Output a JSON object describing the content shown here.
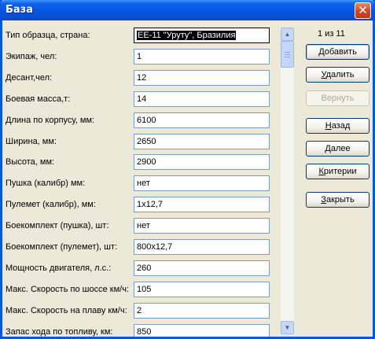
{
  "window": {
    "title": "База",
    "close_glyph": "✕"
  },
  "form": {
    "fields": [
      {
        "label": "Тип образца, страна:",
        "value": "EE-11 \"Уруту\", Бразилия",
        "selected": true
      },
      {
        "label": "Экипаж, чел:",
        "value": "1"
      },
      {
        "label": "Десант,чел:",
        "value": "12"
      },
      {
        "label": "Боевая масса,т:",
        "value": "14"
      },
      {
        "label": "Длина по корпусу, мм:",
        "value": "6100"
      },
      {
        "label": "Ширина, мм:",
        "value": "2650"
      },
      {
        "label": "Высота, мм:",
        "value": "2900"
      },
      {
        "label": "Пушка (калибр) мм:",
        "value": "нет"
      },
      {
        "label": "Пулемет (калибр), мм:",
        "value": "1x12,7"
      },
      {
        "label": "Боекомплект (пушка), шт:",
        "value": "нет"
      },
      {
        "label": "Боекомплект (пулемет), шт:",
        "value": "800x12,7"
      },
      {
        "label": "Мощность двигателя, л.с.:",
        "value": "260"
      },
      {
        "label": "Макс. Скорость по шоссе км/ч:",
        "value": "105"
      },
      {
        "label": "Макс. Скорость на плаву км/ч:",
        "value": "2"
      },
      {
        "label": "Запас хода по топливу, км:",
        "value": "850"
      }
    ]
  },
  "record_counter": "1 из 11",
  "buttons": {
    "add": {
      "before": "",
      "key": "Д",
      "after": "обавить"
    },
    "delete": {
      "before": "",
      "key": "У",
      "after": "далить"
    },
    "restore": {
      "label": "Вернуть",
      "enabled": false
    },
    "back": {
      "before": "",
      "key": "Н",
      "after": "азад"
    },
    "next": {
      "before": "",
      "key": "Д",
      "after": "алее"
    },
    "criteria": {
      "before": "",
      "key": "К",
      "after": "ритерии"
    },
    "close": {
      "before": "",
      "key": "З",
      "after": "акрыть"
    }
  },
  "scrollbar": {
    "up_icon": "▲",
    "down_icon": "▼"
  },
  "colors": {
    "title_bar": "#0553e0",
    "close_button": "#d2461f",
    "dialog_bg": "#ece9d8",
    "field_border": "#7f9db9"
  }
}
